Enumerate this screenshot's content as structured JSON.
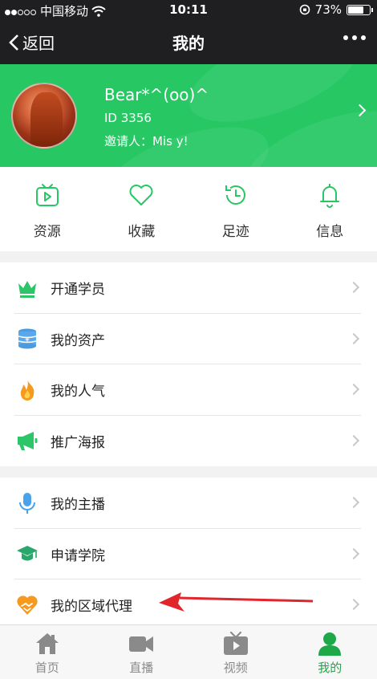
{
  "status_bar": {
    "carrier": "中国移动",
    "time": "10:11",
    "battery": "73%",
    "battery_level": 0.73
  },
  "nav": {
    "back_label": "返回",
    "title": "我的"
  },
  "profile": {
    "name": "Bear*^(oo)^",
    "id": "ID 3356",
    "inviter": "邀请人：Mis y!"
  },
  "quick_actions": [
    {
      "label": "资源",
      "icon": "tv-icon"
    },
    {
      "label": "收藏",
      "icon": "heart-icon"
    },
    {
      "label": "足迹",
      "icon": "history-icon"
    },
    {
      "label": "信息",
      "icon": "bell-icon"
    }
  ],
  "menu_group1": [
    {
      "label": "开通学员",
      "icon": "crown-icon"
    },
    {
      "label": "我的资产",
      "icon": "coin-stack-icon"
    },
    {
      "label": "我的人气",
      "icon": "flame-icon"
    },
    {
      "label": "推广海报",
      "icon": "megaphone-icon"
    }
  ],
  "menu_group2": [
    {
      "label": "我的主播",
      "icon": "microphone-icon"
    },
    {
      "label": "申请学院",
      "icon": "graduation-cap-icon"
    },
    {
      "label": "我的区域代理",
      "icon": "handshake-icon"
    }
  ],
  "tab_bar": [
    {
      "label": "首页",
      "icon": "home-icon"
    },
    {
      "label": "直播",
      "icon": "video-camera-icon"
    },
    {
      "label": "视频",
      "icon": "tv-play-icon"
    },
    {
      "label": "我的",
      "icon": "person-icon",
      "active": true
    }
  ],
  "colors": {
    "brand_green": "#27c864",
    "active_tab": "#1ea84a",
    "annotation_red": "#e0262b"
  }
}
